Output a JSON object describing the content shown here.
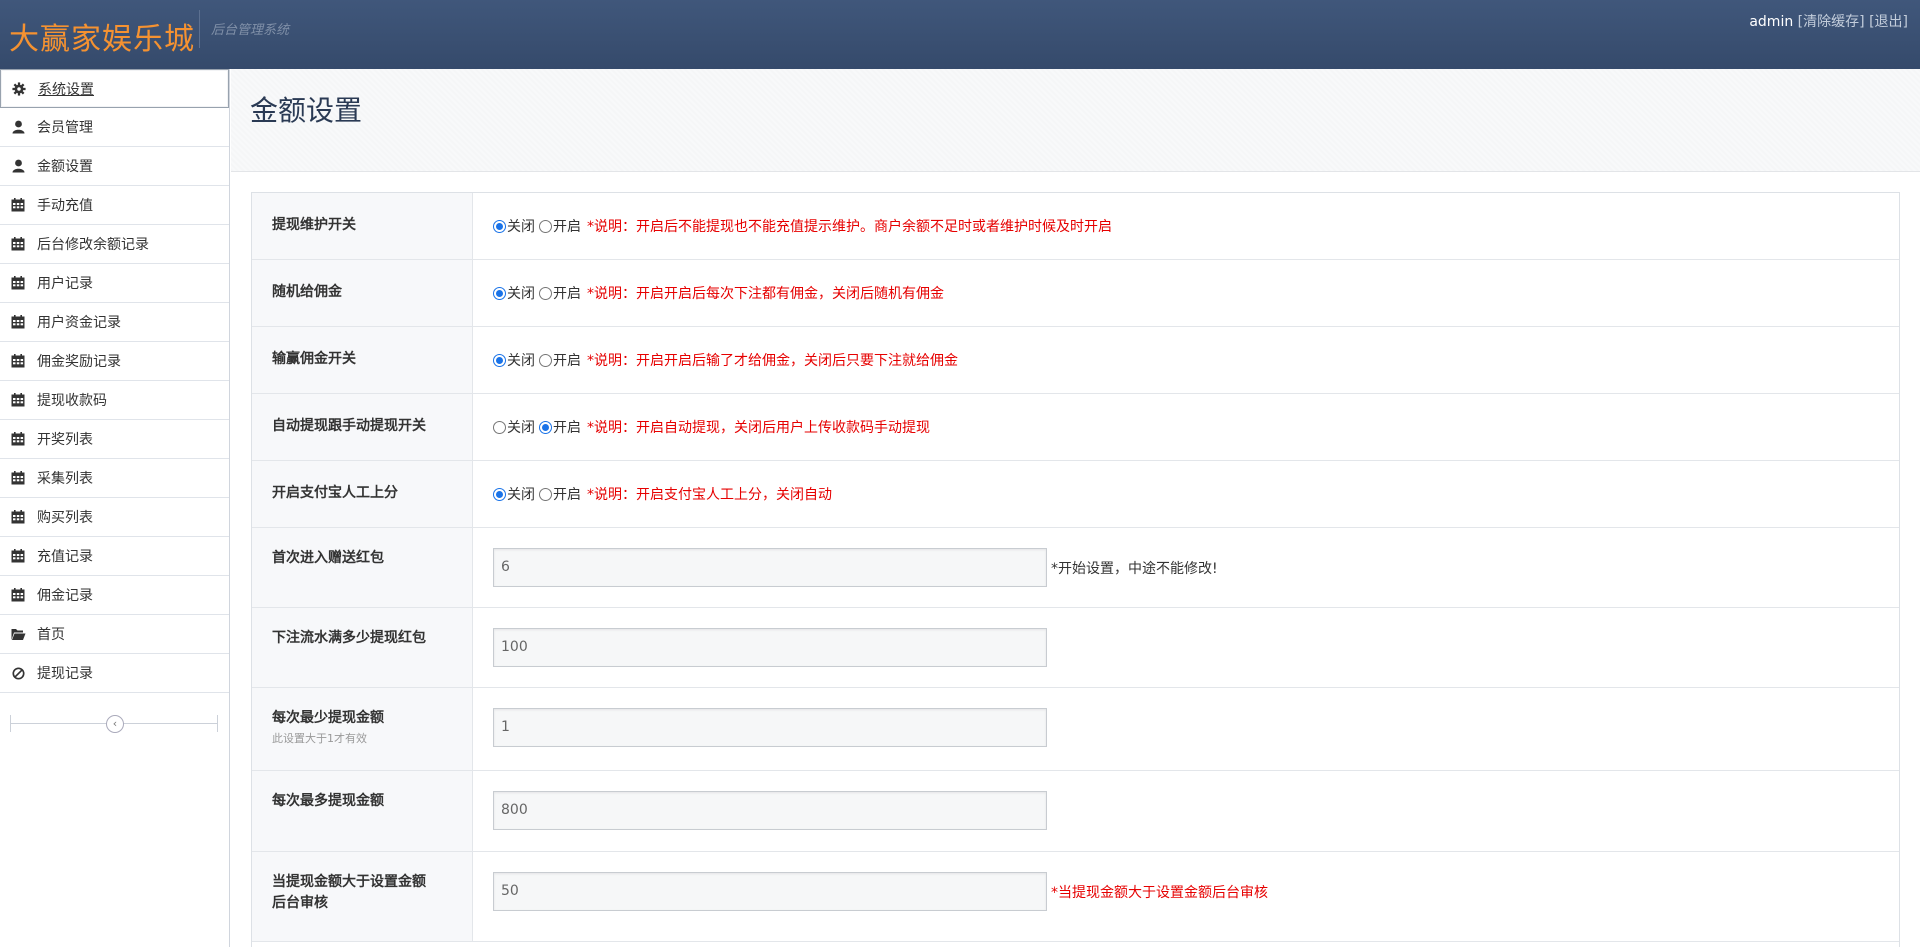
{
  "header": {
    "brand": "大赢家娱乐城",
    "subtitle": "后台管理系统",
    "username": "admin",
    "clear_cache": "[清除缓存]",
    "logout": "[退出]"
  },
  "sidebar": {
    "items": [
      {
        "label": "系统设置",
        "icon": "gear-icon"
      },
      {
        "label": "会员管理",
        "icon": "user-icon"
      },
      {
        "label": "金额设置",
        "icon": "user-icon"
      },
      {
        "label": "手动充值",
        "icon": "calendar-icon"
      },
      {
        "label": "后台修改余额记录",
        "icon": "calendar-icon"
      },
      {
        "label": "用户记录",
        "icon": "calendar-icon"
      },
      {
        "label": "用户资金记录",
        "icon": "calendar-icon"
      },
      {
        "label": "佣金奖励记录",
        "icon": "calendar-icon"
      },
      {
        "label": "提现收款码",
        "icon": "calendar-icon"
      },
      {
        "label": "开奖列表",
        "icon": "calendar-icon"
      },
      {
        "label": "采集列表",
        "icon": "calendar-icon"
      },
      {
        "label": "购买列表",
        "icon": "calendar-icon"
      },
      {
        "label": "充值记录",
        "icon": "calendar-icon"
      },
      {
        "label": "佣金记录",
        "icon": "calendar-icon"
      },
      {
        "label": "首页",
        "icon": "folder-open-icon"
      },
      {
        "label": "提现记录",
        "icon": "ban-icon"
      }
    ],
    "collapse_icon": "chevron-left-icon"
  },
  "page": {
    "title": "金额设置"
  },
  "form": {
    "option_off": "关闭",
    "option_on": "开启",
    "toggles": [
      {
        "label": "提现维护开关",
        "selected": "off",
        "note": "*说明：开启后不能提现也不能充值提示维护。商户余额不足时或者维护时候及时开启"
      },
      {
        "label": "随机给佣金",
        "selected": "off",
        "note": "*说明：开启开启后每次下注都有佣金，关闭后随机有佣金"
      },
      {
        "label": "输赢佣金开关",
        "selected": "off",
        "note": "*说明：开启开启后输了才给佣金，关闭后只要下注就给佣金"
      },
      {
        "label": "自动提现跟手动提现开关",
        "selected": "on",
        "note": "*说明：开启自动提现，关闭后用户上传收款码手动提现"
      },
      {
        "label": "开启支付宝人工上分",
        "selected": "off",
        "note": "*说明：开启支付宝人工上分，关闭自动"
      }
    ],
    "inputs": [
      {
        "label": "首次进入赠送红包",
        "hint": "",
        "value": "6",
        "note": "*开始设置，中途不能修改!"
      },
      {
        "label": "下注流水满多少提现红包",
        "hint": "",
        "value": "100",
        "note": ""
      },
      {
        "label": "每次最少提现金额",
        "hint": "此设置大于1才有效",
        "value": "1",
        "note": ""
      },
      {
        "label": "每次最多提现金额",
        "hint": "",
        "value": "800",
        "note": ""
      },
      {
        "label": "当提现金额大于设置金额后台审核",
        "label_line1": "当提现金额大于设置金额",
        "label_line2": "后台审核",
        "hint": "",
        "value": "50",
        "note": "*当提现金额大于设置金额后台审核"
      }
    ]
  },
  "colors": {
    "navbar": "#3a5072",
    "brand": "#f59231",
    "note_red": "#e60000",
    "radio_selected": "#1a73e8"
  }
}
